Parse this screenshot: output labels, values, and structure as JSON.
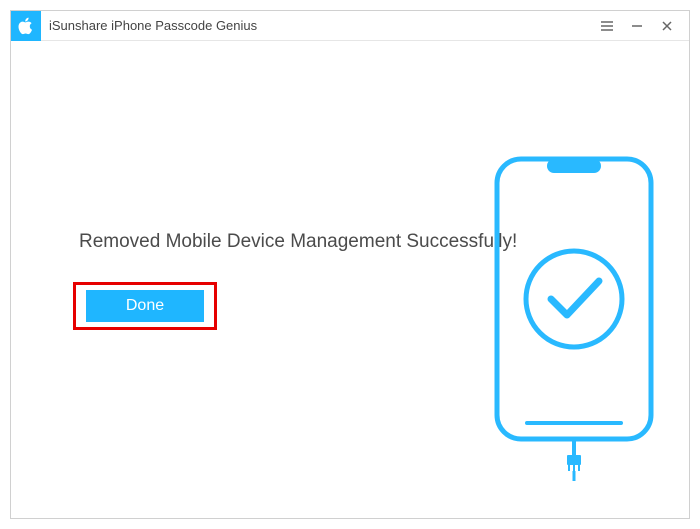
{
  "app": {
    "title": "iSunshare iPhone Passcode Genius"
  },
  "main": {
    "status_message": "Removed Mobile Device Management Successfully!",
    "done_label": "Done"
  },
  "colors": {
    "accent": "#1fb6ff",
    "highlight_border": "#e60000"
  }
}
